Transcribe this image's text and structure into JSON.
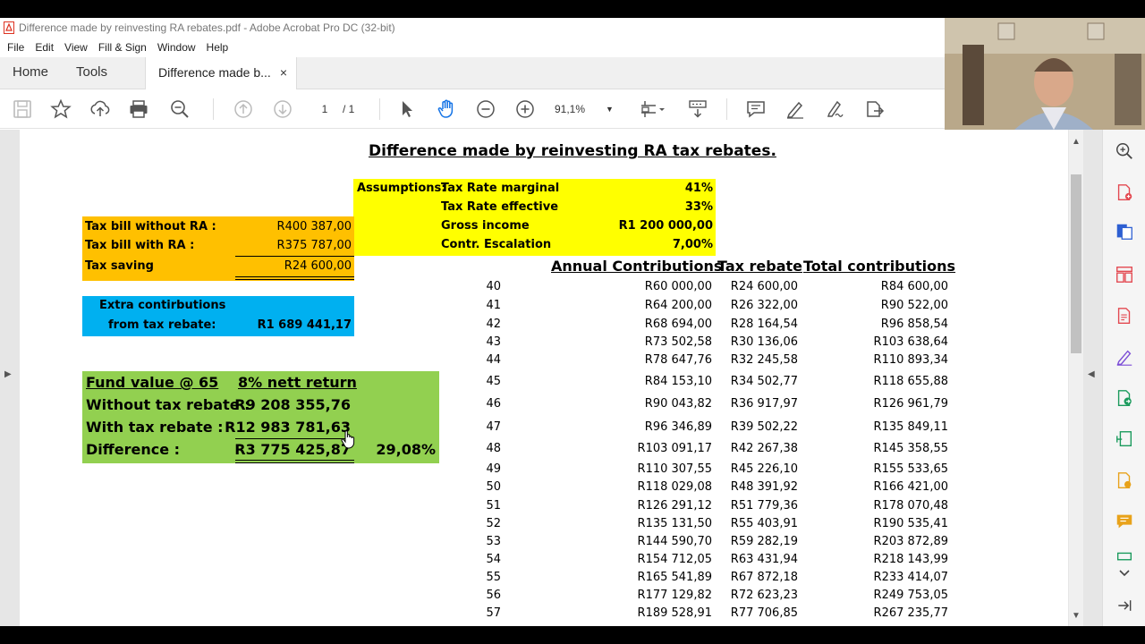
{
  "window": {
    "title": "Difference made by reinvesting RA rebates.pdf - Adobe Acrobat Pro DC (32-bit)"
  },
  "menu": [
    "File",
    "Edit",
    "View",
    "Fill & Sign",
    "Window",
    "Help"
  ],
  "tabs": {
    "home": "Home",
    "tools": "Tools",
    "document": "Difference made b...",
    "close": "×"
  },
  "toolbar": {
    "page_current": "1",
    "page_total": "/ 1",
    "zoom": "91,1%"
  },
  "sheet": {
    "title": "Difference made by reinvesting RA tax rebates.",
    "assumptions": {
      "label": "Assumptions:",
      "rows": [
        {
          "label": "Tax Rate marginal",
          "value": "41%"
        },
        {
          "label": "Tax Rate effective",
          "value": "33%"
        },
        {
          "label": "Gross income",
          "value": "R1 200 000,00"
        },
        {
          "label": "Contr. Escalation",
          "value": "7,00%"
        }
      ]
    },
    "taxbill": {
      "without_label": "Tax bill without RA :",
      "without_value": "R400 387,00",
      "with_label": "Tax bill with RA :",
      "with_value": "R375 787,00",
      "saving_label": "Tax saving",
      "saving_value": "R24 600,00"
    },
    "extra": {
      "line1": "Extra contirbutions",
      "line2": "from tax rebate:",
      "value": "R1 689 441,17"
    },
    "fund": {
      "header": "Fund value @ 65",
      "return_header": "8% nett return",
      "without_label": "Without tax rebate :",
      "without_value": "R9 208 355,76",
      "with_label": "With tax rebate :",
      "with_value": "R12 983 781,63",
      "diff_label": "Difference :",
      "diff_value": "R3 775 425,87",
      "diff_pct": "29,08%"
    },
    "table": {
      "headers": [
        "Annual Contributions",
        "Tax rebate",
        "Total contributions"
      ],
      "rows": [
        [
          "40",
          "R60 000,00",
          "R24 600,00",
          "R84 600,00"
        ],
        [
          "41",
          "R64 200,00",
          "R26 322,00",
          "R90 522,00"
        ],
        [
          "42",
          "R68 694,00",
          "R28 164,54",
          "R96 858,54"
        ],
        [
          "43",
          "R73 502,58",
          "R30 136,06",
          "R103 638,64"
        ],
        [
          "44",
          "R78 647,76",
          "R32 245,58",
          "R110 893,34"
        ],
        [
          "45",
          "R84 153,10",
          "R34 502,77",
          "R118 655,88"
        ],
        [
          "46",
          "R90 043,82",
          "R36 917,97",
          "R126 961,79"
        ],
        [
          "47",
          "R96 346,89",
          "R39 502,22",
          "R135 849,11"
        ],
        [
          "48",
          "R103 091,17",
          "R42 267,38",
          "R145 358,55"
        ],
        [
          "49",
          "R110 307,55",
          "R45 226,10",
          "R155 533,65"
        ],
        [
          "50",
          "R118 029,08",
          "R48 391,92",
          "R166 421,00"
        ],
        [
          "51",
          "R126 291,12",
          "R51 779,36",
          "R178 070,48"
        ],
        [
          "52",
          "R135 131,50",
          "R55 403,91",
          "R190 535,41"
        ],
        [
          "53",
          "R144 590,70",
          "R59 282,19",
          "R203 872,89"
        ],
        [
          "54",
          "R154 712,05",
          "R63 431,94",
          "R218 143,99"
        ],
        [
          "55",
          "R165 541,89",
          "R67 872,18",
          "R233 414,07"
        ],
        [
          "56",
          "R177 129,82",
          "R72 623,23",
          "R249 753,05"
        ],
        [
          "57",
          "R189 528,91",
          "R77 706,85",
          "R267 235,77"
        ]
      ]
    }
  },
  "icons": {
    "toolbar": [
      "save-icon",
      "star-icon",
      "upload-icon",
      "print-icon",
      "zoom-out-search-icon",
      "prev-page-icon",
      "next-page-icon",
      "select-cursor-icon",
      "hand-icon",
      "zoom-minus-icon",
      "zoom-plus-icon",
      "fit-page-icon",
      "scroll-mode-icon",
      "comment-icon",
      "highlight-pen-icon",
      "sign-icon",
      "share-icon"
    ],
    "right_pane": [
      "search-zoom-icon",
      "create-pdf-icon",
      "export-pdf-icon",
      "organize-pages-icon",
      "edit-pdf-icon",
      "fill-sign-icon",
      "send-review-icon",
      "compress-icon",
      "scan-icon",
      "comment-icon",
      "more-tools-icon",
      "chevron-down-icon",
      "collapse-pane-icon"
    ]
  },
  "colors": {
    "yellow": "#ffff00",
    "orange": "#ffc000",
    "blue": "#00b0f0",
    "green": "#92d050"
  }
}
